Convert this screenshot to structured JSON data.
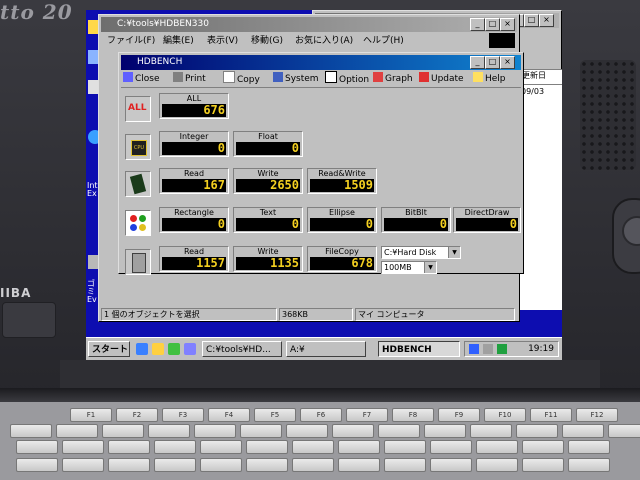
{
  "laptop": {
    "brand": "tto 20",
    "maker": "IIBA"
  },
  "explorer": {
    "title": "C:¥tools¥HDBEN330",
    "menu": [
      "ファイル(F)",
      "編集(E)",
      "表示(V)",
      "移動(G)",
      "お気に入り(A)",
      "ヘルプ(H)"
    ],
    "status": [
      "1 個のオブジェクトを選択",
      "368KB",
      "マイ コンピュータ"
    ]
  },
  "hdbench": {
    "title": "HDBENCH",
    "toolbar": [
      "Close",
      "Print",
      "Copy",
      "System",
      "Option",
      "Graph",
      "Update",
      "Help"
    ],
    "all": {
      "icon_label": "ALL",
      "label": "ALL",
      "value": "676"
    },
    "cpu": {
      "icon_label": "CPU",
      "integer_label": "Integer",
      "integer": "0",
      "float_label": "Float",
      "float": "0"
    },
    "memory": {
      "read_label": "Read",
      "read": "167",
      "write_label": "Write",
      "write": "2650",
      "rw_label": "Read&Write",
      "rw": "1509"
    },
    "video": {
      "rect_label": "Rectangle",
      "rect": "0",
      "text_label": "Text",
      "text": "0",
      "ellipse_label": "Ellipse",
      "ellipse": "0",
      "bitblt_label": "BitBlt",
      "bitblt": "0",
      "dd_label": "DirectDraw",
      "dd": "0"
    },
    "drive": {
      "read_label": "Read",
      "read": "1157",
      "write_label": "Write",
      "write": "1135",
      "copy_label": "FileCopy",
      "copy": "678",
      "drive_select": "C:¥Hard Disk",
      "size_select": "100MB"
    }
  },
  "other_window": {
    "right_edge_text": "更新日",
    "date": "09/03"
  },
  "desktop_labels": {
    "ie": "Int Ex",
    "recycle": "ゴミ Ev"
  },
  "taskbar": {
    "start": "スタート",
    "buttons": [
      "C:¥tools¥HD...",
      "A:¥",
      "HDBENCH"
    ],
    "clock": "19:19"
  },
  "keyboard": {
    "fkeys": [
      "F1",
      "F2",
      "F3",
      "F4",
      "F5",
      "F6",
      "F7",
      "F8",
      "F9",
      "F10",
      "F11",
      "F12"
    ]
  },
  "colors": {
    "desktop": "#0d0db0",
    "title_active": "#00006e",
    "score_text": "#f4d020"
  }
}
